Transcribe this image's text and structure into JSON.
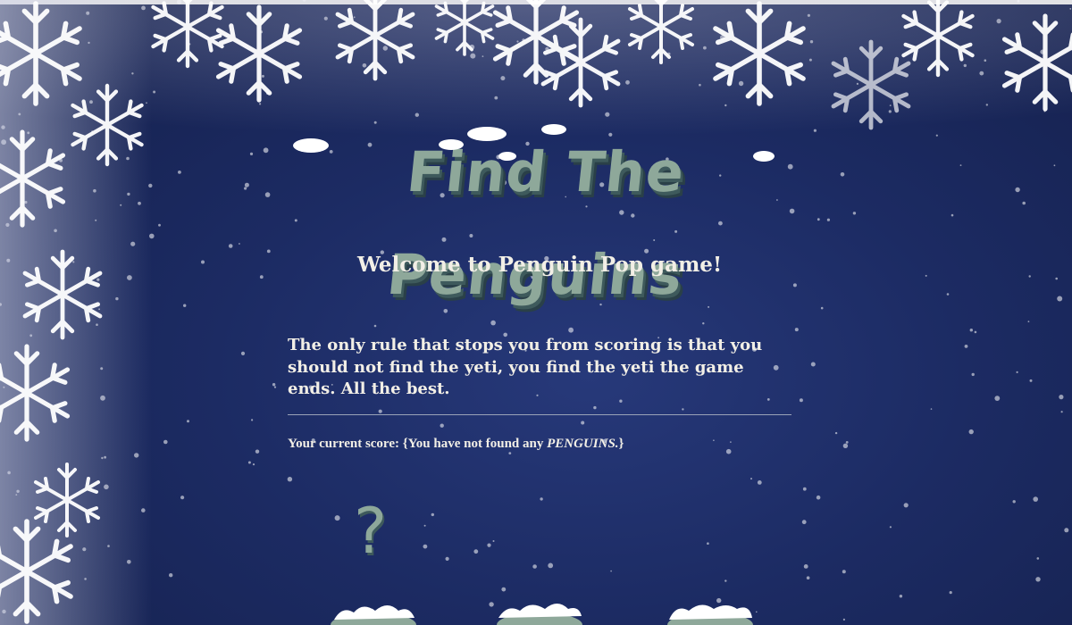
{
  "game": {
    "title": "Find The Penguins",
    "welcome": "Welcome to Penguin Pop game!",
    "rules": "The only rule that stops you from scoring is that you should not find the yeti, you find the yeti the game ends. All the best.",
    "score_prefix": "Your current score: {You have not found any ",
    "score_emphasis": "PENGUINS.",
    "score_suffix": "}",
    "hidden_tile_symbol": "?"
  },
  "colors": {
    "background": "#1c2b63",
    "title_fill": "#8ea89a",
    "title_shadow": "#3e5a5c",
    "text": "#f2efe6",
    "snow": "#ffffff"
  },
  "icons": [
    "snowflake-icon",
    "question-mark-icon",
    "snow-mound-icon"
  ]
}
